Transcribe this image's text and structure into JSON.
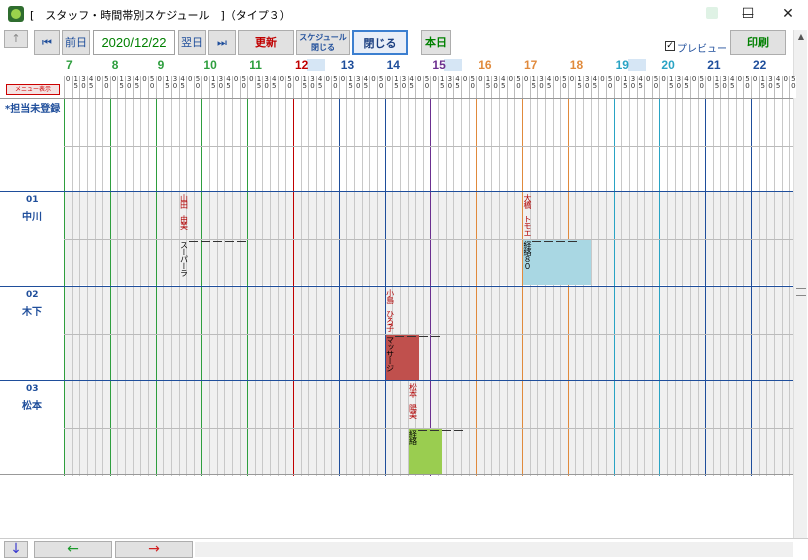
{
  "window": {
    "title": "[　スタッフ・時間帯別スケジュール　]（タイプ３）",
    "minimize_glyph": "—",
    "maximize_glyph": "☐",
    "close_glyph": "✕"
  },
  "toolbar": {
    "up_glyph": "↑",
    "first_glyph": "⏮",
    "prev_day": "前日",
    "date": "2020/12/22",
    "next_day": "翌日",
    "last_glyph": "⏭",
    "refresh": "更新",
    "schedule_close_line1": "スケジュール",
    "schedule_close_line2": "閉じる",
    "close": "閉じる",
    "today": "本日",
    "preview_label": "プレビュー",
    "preview_check_glyph": "✓",
    "print": "印刷"
  },
  "grid": {
    "menu_button": "メニュー表示",
    "hours": [
      {
        "label": "7",
        "color": "#2e9e3e",
        "highlight": ""
      },
      {
        "label": "8",
        "color": "#2e9e3e",
        "highlight": ""
      },
      {
        "label": "9",
        "color": "#2e9e3e",
        "highlight": ""
      },
      {
        "label": "10",
        "color": "#2e9e3e",
        "highlight": ""
      },
      {
        "label": "11",
        "color": "#2e9e3e",
        "highlight": ""
      },
      {
        "label": "12",
        "color": "#c00000",
        "highlight": "#d6e6f5"
      },
      {
        "label": "13",
        "color": "#1f4e9b",
        "highlight": ""
      },
      {
        "label": "14",
        "color": "#1f4e9b",
        "highlight": ""
      },
      {
        "label": "15",
        "color": "#6b2f8f",
        "highlight": "#d6e6f5"
      },
      {
        "label": "16",
        "color": "#e08a3c",
        "highlight": ""
      },
      {
        "label": "17",
        "color": "#e08a3c",
        "highlight": ""
      },
      {
        "label": "18",
        "color": "#e08a3c",
        "highlight": ""
      },
      {
        "label": "19",
        "color": "#29a3c4",
        "highlight": "#d6e6f5"
      },
      {
        "label": "20",
        "color": "#29a3c4",
        "highlight": ""
      },
      {
        "label": "21",
        "color": "#1f4e9b",
        "highlight": ""
      },
      {
        "label": "22",
        "color": "#1f4e9b",
        "highlight": ""
      }
    ],
    "minute_top": [
      "0",
      "1",
      "3",
      "4"
    ],
    "minute_bottom": [
      "",
      "5",
      "0",
      "5"
    ],
    "minute_row2_bottom": [
      "",
      "0",
      "",
      ""
    ],
    "unassigned_label": "*担当未登録",
    "staff": [
      {
        "id": "01",
        "name": "中川"
      },
      {
        "id": "02",
        "name": "木下"
      },
      {
        "id": "03",
        "name": "松本"
      }
    ],
    "events": [
      {
        "staff": 0,
        "name": "山田　由美",
        "desc": "スーパーラ",
        "color": "",
        "start_hour": 9.5,
        "end_hour": 10.9
      },
      {
        "staff": 0,
        "name": "大橋　トモエ",
        "desc": "経絡８０",
        "color": "#a9d7e3",
        "start_hour": 17.0,
        "end_hour": 18.5
      },
      {
        "staff": 1,
        "name": "小島　ひろ子",
        "desc": "マッサージ",
        "color": "#c0504d",
        "start_hour": 14.0,
        "end_hour": 14.75
      },
      {
        "staff": 2,
        "name": "松本　陽美",
        "desc": "経絡",
        "color": "#9acd50",
        "start_hour": 14.5,
        "end_hour": 15.25
      }
    ]
  },
  "bottom": {
    "down_glyph": "↓",
    "left_glyph": "←",
    "right_glyph": "→"
  },
  "scroll": {
    "up_glyph": "▲"
  }
}
